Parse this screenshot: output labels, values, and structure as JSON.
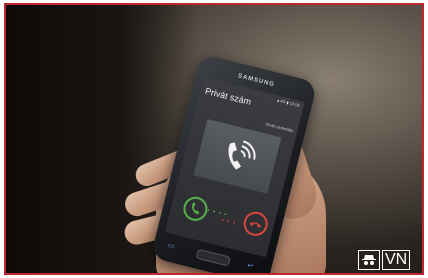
{
  "phone": {
    "brand": "SAMSUNG",
    "status_bar": "▲4G ▮ 13:05",
    "caller_name": "Privát szám",
    "reject_with_message": "Hívás elutasítás",
    "accept_icon": "phone-accept-icon",
    "decline_icon": "phone-decline-icon",
    "caller_avatar_icon": "phone-ringing-icon"
  },
  "watermark": {
    "logo_text": "VN"
  },
  "colors": {
    "frame_border": "#c0262d",
    "accept_green": "#56b04a",
    "decline_red": "#d8453a"
  }
}
